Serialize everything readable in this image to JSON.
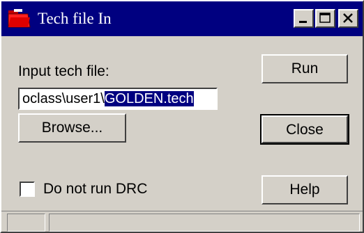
{
  "window": {
    "title": "Tech file In",
    "icon": "red-folder-icon"
  },
  "titlebar_buttons": {
    "minimize_icon": "minimize-icon",
    "maximize_icon": "maximize-icon",
    "close_icon": "close-icon"
  },
  "form": {
    "input_label": "Input tech file:",
    "input_value_prefix": "oclass\\user1\\",
    "input_value_selected": "GOLDEN.tech",
    "checkbox_label": "Do not run DRC",
    "checkbox_checked": false
  },
  "buttons": {
    "run": "Run",
    "browse": "Browse...",
    "close": "Close",
    "help": "Help"
  },
  "colors": {
    "titlebar": "#000080",
    "face": "#d4d0c8",
    "selection": "#000080"
  }
}
